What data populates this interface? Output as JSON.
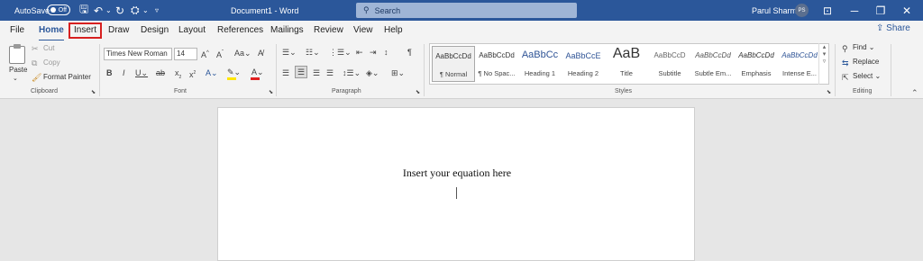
{
  "titlebar": {
    "autosave_label": "AutoSave",
    "autosave_state": "Off",
    "doc_title": "Document1 - Word",
    "search_placeholder": "Search",
    "user_name": "Parul Sharma",
    "user_initials": "PS"
  },
  "tabs": [
    "File",
    "Home",
    "Insert",
    "Draw",
    "Design",
    "Layout",
    "References",
    "Mailings",
    "Review",
    "View",
    "Help"
  ],
  "share_label": "Share",
  "clipboard": {
    "paste": "Paste",
    "cut": "Cut",
    "copy": "Copy",
    "format_painter": "Format Painter",
    "label": "Clipboard"
  },
  "font": {
    "name": "Times New Roman",
    "size": "14",
    "label": "Font"
  },
  "paragraph": {
    "label": "Paragraph"
  },
  "styles": {
    "label": "Styles",
    "items": [
      {
        "sample": "AaBbCcDd",
        "name": "¶ Normal"
      },
      {
        "sample": "AaBbCcDd",
        "name": "¶ No Spac..."
      },
      {
        "sample": "AaBbCc",
        "name": "Heading 1"
      },
      {
        "sample": "AaBbCcE",
        "name": "Heading 2"
      },
      {
        "sample": "AaB",
        "name": "Title"
      },
      {
        "sample": "AaBbCcD",
        "name": "Subtitle"
      },
      {
        "sample": "AaBbCcDd",
        "name": "Subtle Em..."
      },
      {
        "sample": "AaBbCcDd",
        "name": "Emphasis"
      },
      {
        "sample": "AaBbCcDd",
        "name": "Intense E..."
      }
    ]
  },
  "editing": {
    "find": "Find",
    "replace": "Replace",
    "select": "Select",
    "label": "Editing"
  },
  "document": {
    "text": "Insert your equation here"
  },
  "colors": {
    "title_bar": "#2b579a",
    "highlight_tab_border": "#d72020",
    "highlight_yellow": "#ffe600",
    "font_color_red": "#e02020"
  }
}
